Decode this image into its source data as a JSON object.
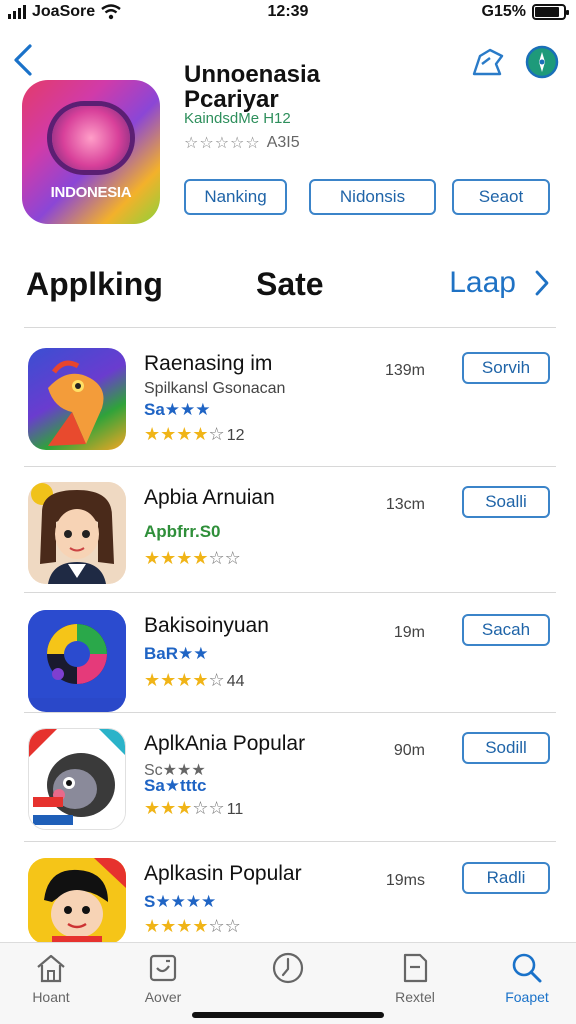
{
  "status_bar": {
    "carrier": "JoaSore",
    "time": "12:39",
    "battery": "G15%",
    "battery_level": 0.85
  },
  "header": {
    "back_icon": "chevron-left-icon",
    "share_icon": "share-icon",
    "compass_icon": "compass-icon"
  },
  "hero": {
    "icon_label": "INDONESIA",
    "title_line1": "Unnoenasia",
    "title_line2": "Pcariyar",
    "subtitle": "KaindsdMe H12",
    "rating_stars": "☆☆☆☆☆",
    "rating_count": "A3I5",
    "chips": [
      "Nanking",
      "Nidonsis",
      "Seaot"
    ]
  },
  "section": {
    "title_left": "Applking",
    "title_mid": "Sate",
    "more_label": "Laap"
  },
  "rows": [
    {
      "title": "Raenasing im",
      "subtitle": "Spilkansl Gsonacan",
      "tag": "Sa★★★",
      "tag_color": "#1f64c4",
      "stars": "★★★★",
      "empty": "☆",
      "count": "12",
      "size": "139m",
      "button": "Sorvih"
    },
    {
      "title": "Apbia Arnuian",
      "subtitle": "",
      "tag": "Apbfrr.S0",
      "tag_color": "#2f8f3a",
      "stars": "★★★★",
      "empty": "☆☆",
      "count": "",
      "size": "13cm",
      "button": "Soalli"
    },
    {
      "title": "Bakisoinyuan",
      "subtitle": "",
      "tag": "BaR★★",
      "tag_color": "#1f64c4",
      "stars": "★★★★",
      "empty": "☆",
      "count": "44",
      "size": "19m",
      "button": "Sacah"
    },
    {
      "title": "AplkAnia Popular",
      "subtitle": "Sc★★★",
      "tag": "Sa★tttc",
      "tag_color": "#1f64c4",
      "stars": "★★★",
      "empty": "☆☆",
      "count": "11",
      "size": "90m",
      "button": "Sodill"
    },
    {
      "title": "Aplkasin Popular",
      "subtitle": "",
      "tag": "S★★★★",
      "tag_color": "#1f64c4",
      "stars": "★★★★",
      "empty": "☆☆",
      "count": "",
      "size": "19ms",
      "button": "Radli"
    }
  ],
  "tabs": [
    {
      "label": "Hoant",
      "icon": "home-icon"
    },
    {
      "label": "Aover",
      "icon": "calendar-icon"
    },
    {
      "label": "",
      "icon": "clock-icon"
    },
    {
      "label": "Rextel",
      "icon": "document-icon"
    },
    {
      "label": "Foapet",
      "icon": "search-icon"
    }
  ],
  "colors": {
    "accent": "#1f72c4",
    "star": "#f0b417",
    "button_border": "#3b84c9"
  }
}
